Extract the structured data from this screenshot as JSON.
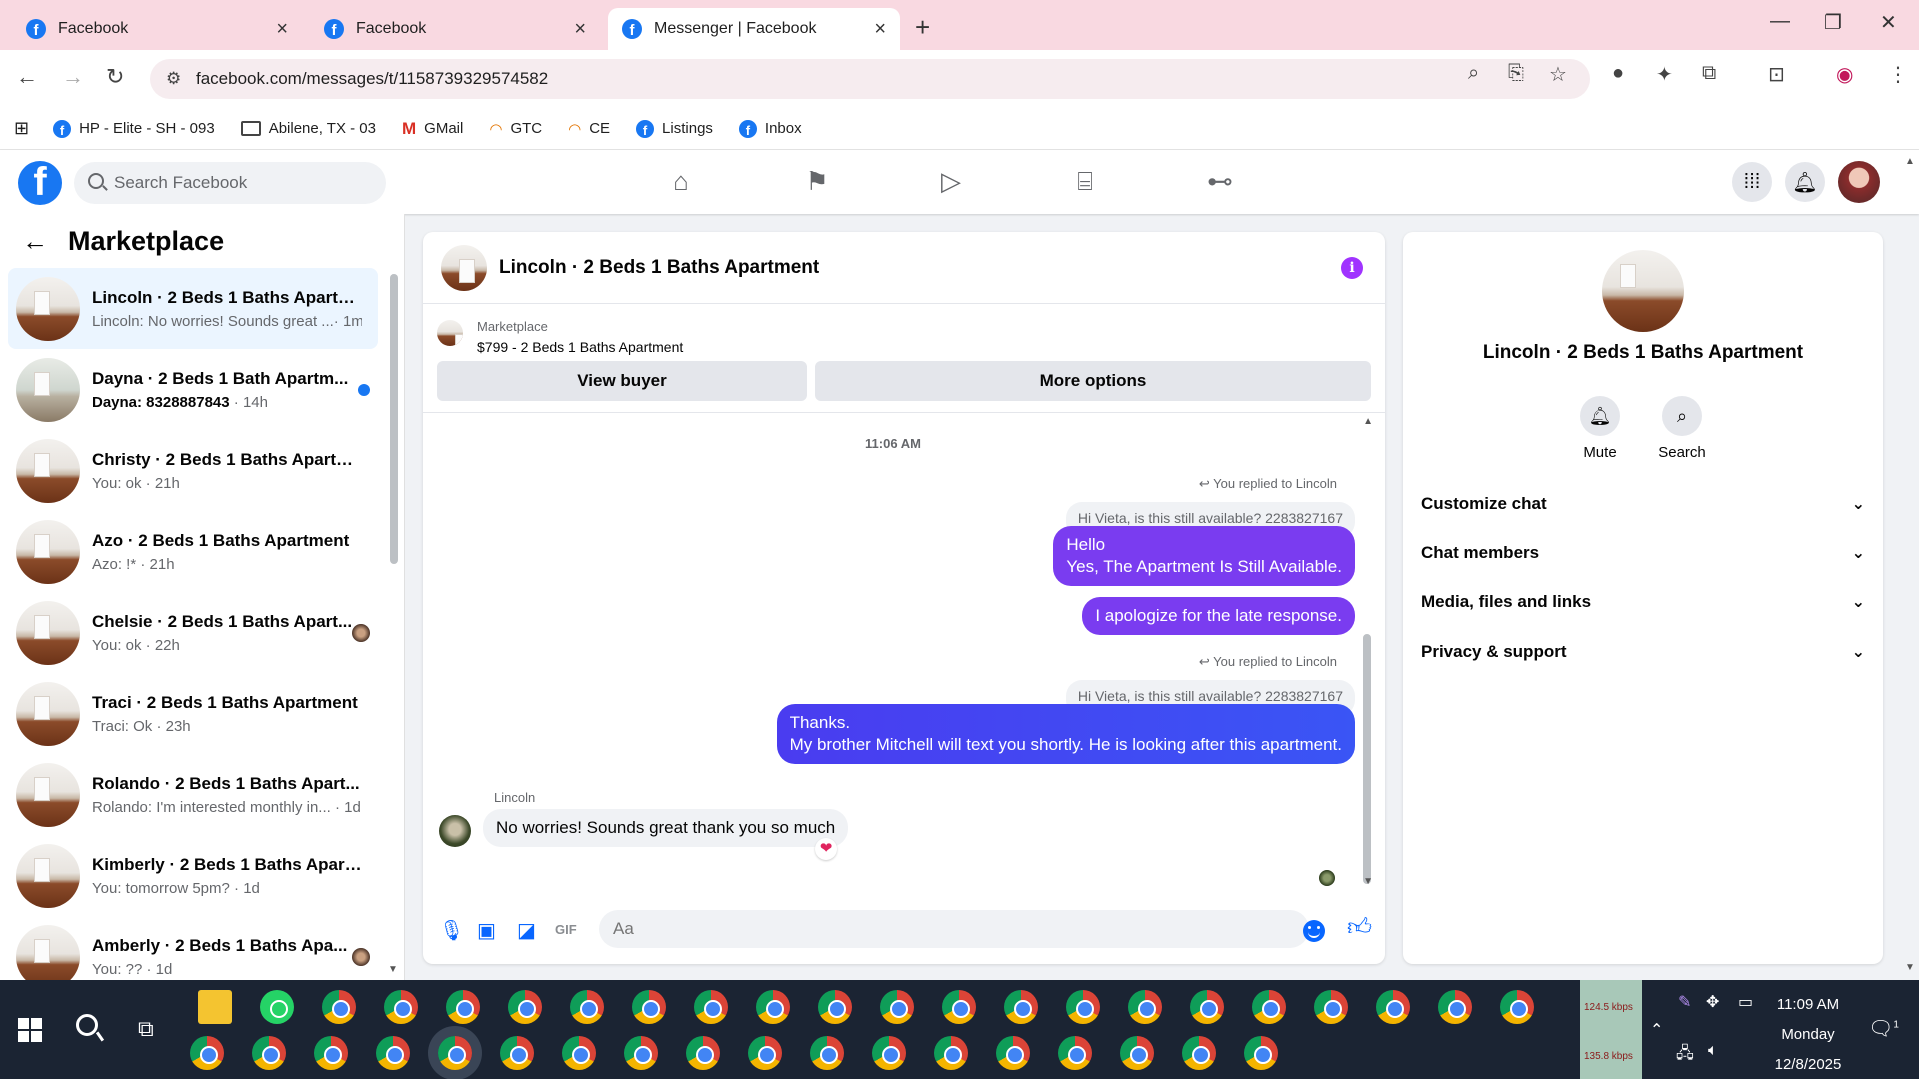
{
  "browser": {
    "tabs": [
      {
        "label": "Facebook",
        "active": false
      },
      {
        "label": "Facebook",
        "active": false
      },
      {
        "label": "Messenger | Facebook",
        "active": true
      }
    ],
    "new_tab": "+",
    "url": "facebook.com/messages/t/1158739329574582",
    "bookmarks": [
      "HP - Elite - SH - 093",
      "Abilene, TX - 03",
      "GMail",
      "GTC",
      "CE",
      "Listings",
      "Inbox"
    ]
  },
  "facebook": {
    "logo": "f",
    "search_placeholder": "Search Facebook"
  },
  "sidebar": {
    "title": "Marketplace",
    "chats": [
      {
        "name": "Lincoln · 2 Beds 1 Baths Apartm...",
        "preview": "Lincoln: No worries! Sounds great ...",
        "time": "· 1m",
        "selected": true
      },
      {
        "name": "Dayna · 2 Beds 1 Bath Apartm...",
        "preview": "Dayna: 8328887843",
        "time": " · 14h",
        "unread": true
      },
      {
        "name": "Christy · 2 Beds 1 Baths Apartm...",
        "preview": "You: ok",
        "time": " · 21h"
      },
      {
        "name": "Azo · 2 Beds 1 Baths Apartment",
        "preview": "Azo: !*",
        "time": " · 21h"
      },
      {
        "name": "Chelsie · 2 Beds 1 Baths Apart...",
        "preview": "You: ok",
        "time": " · 22h",
        "seen": true
      },
      {
        "name": "Traci · 2 Beds 1 Baths Apartment",
        "preview": "Traci: Ok",
        "time": " · 23h"
      },
      {
        "name": "Rolando · 2 Beds 1 Baths Apart...",
        "preview": "Rolando: I'm interested monthly in...",
        "time": " · 1d"
      },
      {
        "name": "Kimberly · 2 Beds 1 Baths Apart...",
        "preview": "You: tomorrow 5pm?",
        "time": " · 1d"
      },
      {
        "name": "Amberly · 2 Beds 1 Baths Apa...",
        "preview": "You: ??",
        "time": " · 1d",
        "seen": true
      }
    ]
  },
  "chat": {
    "title": "Lincoln · 2 Beds 1 Baths Apartment",
    "marketplace_label": "Marketplace",
    "listing": "$799 - 2 Beds 1 Baths Apartment",
    "view_buyer": "View buyer",
    "more_options": "More options",
    "timestamp": "11:06 AM",
    "reply1_label": "You replied to Lincoln",
    "quote1": "Hi Vieta, is this still available? 2283827167",
    "msg1_line1": "Hello",
    "msg1_line2": "Yes, The Apartment Is Still Available.",
    "msg2": "I apologize for the late response.",
    "reply2_label": "You replied to Lincoln",
    "quote2": "Hi Vieta, is this still available? 2283827167",
    "msg3_line1": "Thanks.",
    "msg3_line2": "My brother Mitchell will text you shortly. He is looking after this apartment.",
    "sender": "Lincoln",
    "incoming": "No worries! Sounds great thank you so much",
    "reaction": "❤",
    "input_placeholder": "Aa"
  },
  "info_panel": {
    "title": "Lincoln · 2 Beds 1 Baths Apartment",
    "mute": "Mute",
    "search": "Search",
    "sections": [
      "Customize chat",
      "Chat members",
      "Media, files and links",
      "Privacy & support"
    ]
  },
  "taskbar": {
    "net_up": "124.5 kbps",
    "net_down": "135.8 kbps",
    "time": "11:09 AM",
    "day": "Monday",
    "date": "12/8/2025",
    "notif_count": "1"
  }
}
